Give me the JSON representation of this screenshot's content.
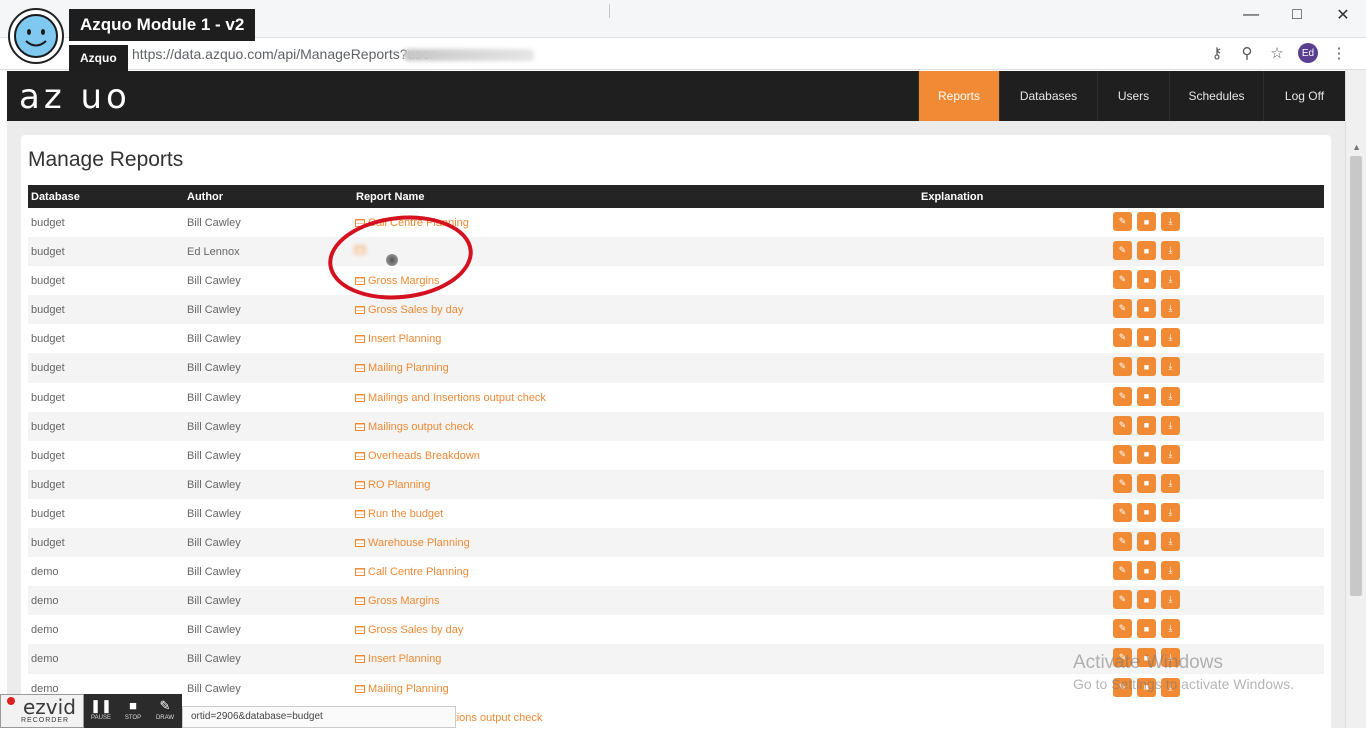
{
  "video": {
    "title": "Azquo Module 1 - v2",
    "channel": "Azquo"
  },
  "browser": {
    "url": "https://data.azquo.com/api/ManageReports?user",
    "profile_initials": "Ed",
    "status_url": "ortid=2906&database=budget"
  },
  "app": {
    "logo": "az uo",
    "nav": [
      {
        "label": "Reports",
        "active": true
      },
      {
        "label": "Databases",
        "active": false
      },
      {
        "label": "Users",
        "active": false
      },
      {
        "label": "Schedules",
        "active": false
      },
      {
        "label": "Log Off",
        "active": false
      }
    ]
  },
  "page": {
    "title": "Manage Reports"
  },
  "table": {
    "headers": {
      "database": "Database",
      "author": "Author",
      "report_name": "Report Name",
      "explanation": "Explanation"
    },
    "rows": [
      {
        "database": "budget",
        "author": "Bill Cawley",
        "report_name": "Call Centre Planning"
      },
      {
        "database": "budget",
        "author": "Ed Lennox",
        "report_name": ""
      },
      {
        "database": "budget",
        "author": "Bill Cawley",
        "report_name": "Gross Margins"
      },
      {
        "database": "budget",
        "author": "Bill Cawley",
        "report_name": "Gross Sales by day"
      },
      {
        "database": "budget",
        "author": "Bill Cawley",
        "report_name": "Insert Planning"
      },
      {
        "database": "budget",
        "author": "Bill Cawley",
        "report_name": "Mailing Planning"
      },
      {
        "database": "budget",
        "author": "Bill Cawley",
        "report_name": "Mailings and Insertions output check"
      },
      {
        "database": "budget",
        "author": "Bill Cawley",
        "report_name": "Mailings output check"
      },
      {
        "database": "budget",
        "author": "Bill Cawley",
        "report_name": "Overheads Breakdown"
      },
      {
        "database": "budget",
        "author": "Bill Cawley",
        "report_name": "RO Planning"
      },
      {
        "database": "budget",
        "author": "Bill Cawley",
        "report_name": "Run the budget"
      },
      {
        "database": "budget",
        "author": "Bill Cawley",
        "report_name": "Warehouse Planning"
      },
      {
        "database": "demo",
        "author": "Bill Cawley",
        "report_name": "Call Centre Planning"
      },
      {
        "database": "demo",
        "author": "Bill Cawley",
        "report_name": "Gross Margins"
      },
      {
        "database": "demo",
        "author": "Bill Cawley",
        "report_name": "Gross Sales by day"
      },
      {
        "database": "demo",
        "author": "Bill Cawley",
        "report_name": "Insert Planning"
      },
      {
        "database": "demo",
        "author": "Bill Cawley",
        "report_name": "Mailing Planning"
      }
    ],
    "partial_last_row_name": "rtions output check"
  },
  "watermark": {
    "line1": "Activate Windows",
    "line2": "Go to Settings to activate Windows."
  },
  "ezvid": {
    "logo": "ezvid",
    "sub": "RECORDER",
    "buttons": [
      "PAUSE",
      "STOP",
      "DRAW"
    ]
  },
  "colors": {
    "accent": "#f08a35",
    "navbar": "#1f1f1f",
    "annotation": "#d4121f"
  }
}
